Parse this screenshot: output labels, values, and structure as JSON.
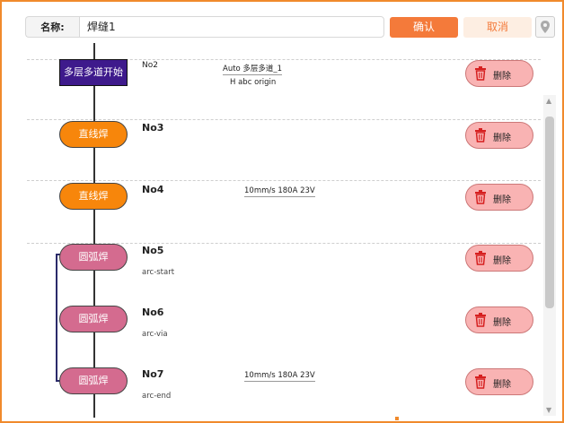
{
  "header": {
    "name_label": "名称:",
    "name_value": "焊缝1",
    "confirm_label": "确认",
    "cancel_label": "取消"
  },
  "steps": [
    {
      "node_label": "多层多道开始",
      "number": "No2",
      "param": "Auto 多层多道_1",
      "param2": "H abc origin",
      "sub": "",
      "delete_label": "删除"
    },
    {
      "node_label": "直线焊",
      "number": "No3",
      "param": "",
      "param2": "",
      "sub": "",
      "delete_label": "删除"
    },
    {
      "node_label": "直线焊",
      "number": "No4",
      "param": "10mm/s 180A 23V",
      "param2": "",
      "sub": "",
      "delete_label": "删除"
    },
    {
      "node_label": "圆弧焊",
      "number": "No5",
      "param": "",
      "param2": "",
      "sub": "arc-start",
      "delete_label": "删除"
    },
    {
      "node_label": "圆弧焊",
      "number": "No6",
      "param": "",
      "param2": "",
      "sub": "arc-via",
      "delete_label": "删除"
    },
    {
      "node_label": "圆弧焊",
      "number": "No7",
      "param": "10mm/s 180A 23V",
      "param2": "",
      "sub": "arc-end",
      "delete_label": "删除"
    }
  ],
  "colors": {
    "accent": "#f47a3a",
    "node_start": "#3e1a8c",
    "node_line": "#f7860b",
    "node_arc": "#d46b8f",
    "delete_bg": "#f9b3b3",
    "trash": "#d62020"
  },
  "icons": {
    "pin": "location-pin-icon",
    "trash": "trash-icon"
  }
}
